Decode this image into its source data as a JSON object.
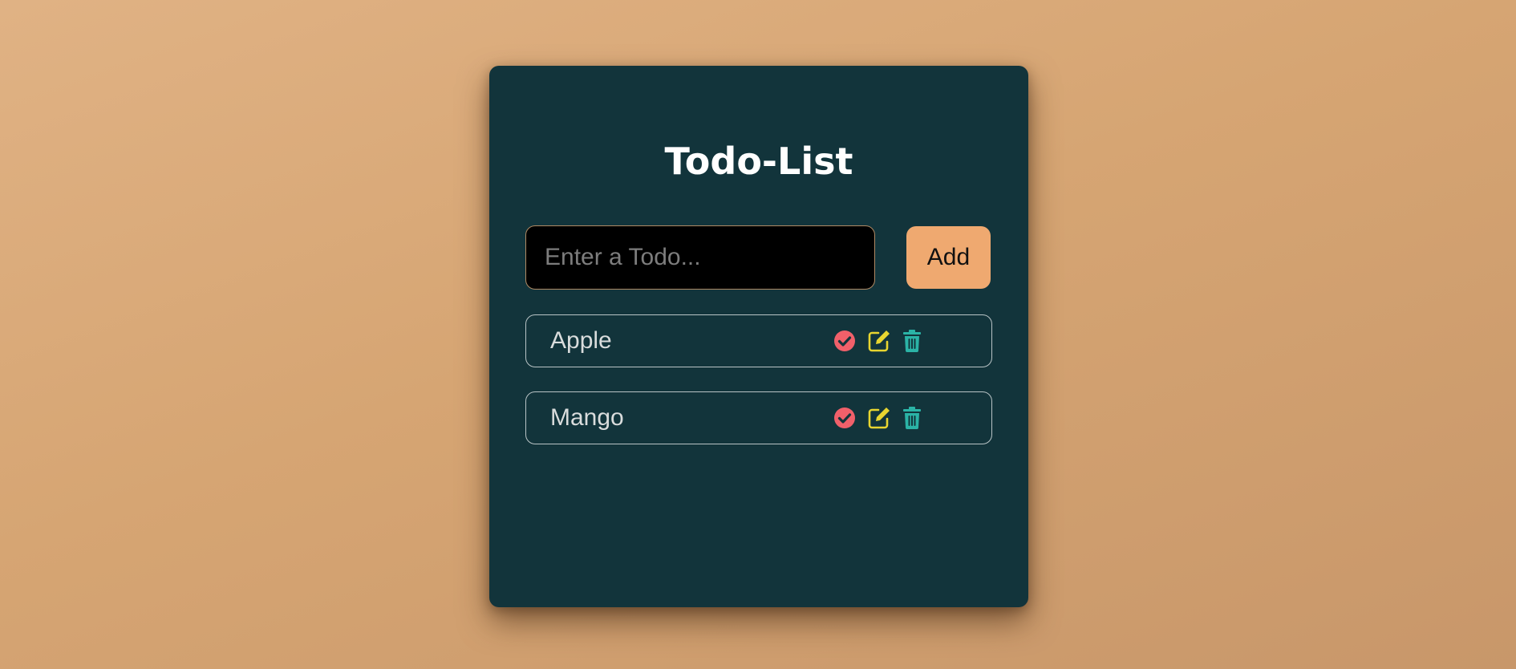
{
  "app": {
    "title": "Todo-List"
  },
  "form": {
    "input_value": "",
    "input_placeholder": "Enter a Todo...",
    "add_label": "Add"
  },
  "todos": [
    {
      "text": "Apple"
    },
    {
      "text": "Mango"
    }
  ],
  "icons": {
    "complete": "check-circle-icon",
    "edit": "edit-icon",
    "delete": "trash-icon"
  },
  "colors": {
    "background": "#d6a573",
    "card": "#12343b",
    "add_button": "#efa970",
    "complete_icon": "#f0606a",
    "edit_icon": "#e8d530",
    "delete_icon": "#2bb3a6"
  }
}
